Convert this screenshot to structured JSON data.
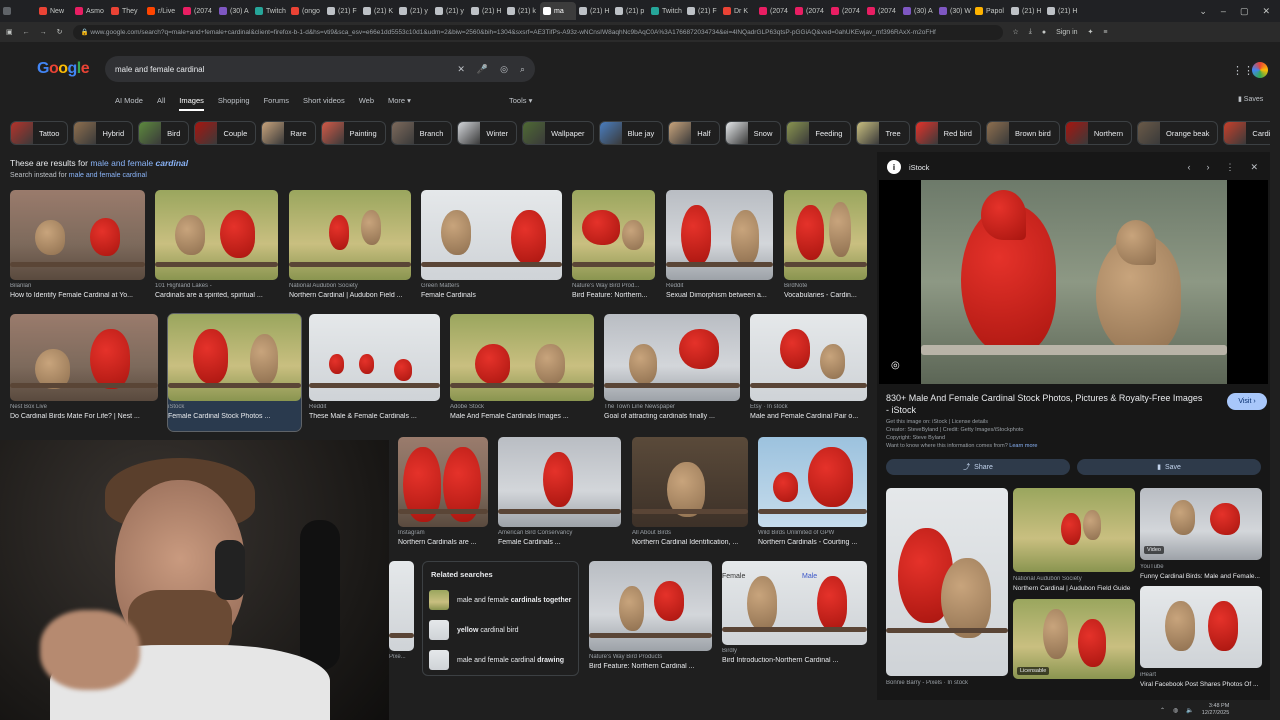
{
  "tabs": [
    {
      "label": "",
      "color": "#5f6368"
    },
    {
      "label": "New",
      "color": "#ea4335"
    },
    {
      "label": "Asmo",
      "color": "#e91e63"
    },
    {
      "label": "They",
      "color": "#ea4335"
    },
    {
      "label": "r/Live",
      "color": "#ff4500"
    },
    {
      "label": "(2074",
      "color": "#e91e63"
    },
    {
      "label": "(30) A",
      "color": "#7e57c2"
    },
    {
      "label": "Twitch",
      "color": "#26a69a"
    },
    {
      "label": "(ongo",
      "color": "#ea4335"
    },
    {
      "label": "(21) F",
      "color": "#bdc1c6"
    },
    {
      "label": "(21) K",
      "color": "#bdc1c6"
    },
    {
      "label": "(21) y",
      "color": "#bdc1c6"
    },
    {
      "label": "(21) y",
      "color": "#bdc1c6"
    },
    {
      "label": "(21) H",
      "color": "#bdc1c6"
    },
    {
      "label": "(21) k",
      "color": "#bdc1c6"
    },
    {
      "label": "ma",
      "color": "#ffffff",
      "active": true
    },
    {
      "label": "(21) H",
      "color": "#bdc1c6"
    },
    {
      "label": "(21) p",
      "color": "#bdc1c6"
    },
    {
      "label": "Twitch",
      "color": "#26a69a"
    },
    {
      "label": "(21) F",
      "color": "#bdc1c6"
    },
    {
      "label": "Dr K",
      "color": "#ea4335"
    },
    {
      "label": "(2074",
      "color": "#e91e63"
    },
    {
      "label": "(2074",
      "color": "#e91e63"
    },
    {
      "label": "(2074",
      "color": "#e91e63"
    },
    {
      "label": "(2074",
      "color": "#e91e63"
    },
    {
      "label": "(30) A",
      "color": "#7e57c2"
    },
    {
      "label": "(30) W",
      "color": "#7e57c2"
    },
    {
      "label": "Papol",
      "color": "#ffb300"
    },
    {
      "label": "(21) H",
      "color": "#bdc1c6"
    },
    {
      "label": "(21) H",
      "color": "#bdc1c6"
    }
  ],
  "window": {
    "signin": "Sign in"
  },
  "address": {
    "url": "www.google.com/search?q=male+and+female+cardinal&client=firefox-b-1-d&hs=vti9&sca_esv=e66e1dd5553c10d1&udm=2&biw=2560&bih=1304&sxsrf=AE3TifPs-A93z-wNCnsIW8aqhNc9bAqC0A%3A1766872034734&ei=4lNQadrGLP63qtsP-pGGiAQ&ved=0ahUKEwjav_mf396RAxX-m2oFHf",
    "signin": "Sign in"
  },
  "google": {
    "logo": "Google",
    "query": "male and female cardinal",
    "nav": [
      "AI Mode",
      "All",
      "Images",
      "Shopping",
      "Forums",
      "Short videos",
      "Web",
      "More ▾"
    ],
    "tools": "Tools ▾",
    "saves": "Saves"
  },
  "chips": [
    {
      "label": "Tattoo",
      "color": "#b5332b"
    },
    {
      "label": "Hybrid",
      "color": "#8e6f4f"
    },
    {
      "label": "Bird",
      "color": "#5d8a3e"
    },
    {
      "label": "Couple",
      "color": "#a8150f"
    },
    {
      "label": "Rare",
      "color": "#c8a47c"
    },
    {
      "label": "Painting",
      "color": "#d35a48"
    },
    {
      "label": "Branch",
      "color": "#7d6a5c"
    },
    {
      "label": "Winter",
      "color": "#d3d6da"
    },
    {
      "label": "Wallpaper",
      "color": "#4f6a34"
    },
    {
      "label": "Blue jay",
      "color": "#4a7ec0"
    },
    {
      "label": "Half",
      "color": "#c8a47c"
    },
    {
      "label": "Snow",
      "color": "#e5e8ea"
    },
    {
      "label": "Feeding",
      "color": "#8a9550"
    },
    {
      "label": "Tree",
      "color": "#c9bf80"
    },
    {
      "label": "Red bird",
      "color": "#e5322a"
    },
    {
      "label": "Brown bird",
      "color": "#8e6f4f"
    },
    {
      "label": "Northern",
      "color": "#a8150f"
    },
    {
      "label": "Orange beak",
      "color": "#6a5a48"
    },
    {
      "label": "Cardinals male",
      "color": "#c8402b"
    }
  ],
  "results_note": {
    "prefix": "These are results for ",
    "query_plain": "male and female ",
    "query_em": "cardinal",
    "instead_prefix": "Search instead for ",
    "instead_link": "male and female cardinal"
  },
  "results": [
    {
      "source": "Bilanlan",
      "title": "How to Identify Female Cardinal at Yo..."
    },
    {
      "source": "101 Highland Lakes -",
      "title": "Cardinals are a spirited, spiritual ..."
    },
    {
      "source": "National Audubon Society",
      "title": "Northern Cardinal | Audubon Field ..."
    },
    {
      "source": "Green Matters",
      "title": "Female Cardinals"
    },
    {
      "source": "Nature's Way Bird Prod...",
      "title": "Bird Feature: Northern..."
    },
    {
      "source": "Reddit",
      "title": "Sexual Dimorphism between a..."
    },
    {
      "source": "BirdNote",
      "title": "Vocabularies - Cardin..."
    },
    {
      "source": "Nest Box Live",
      "title": "Do Cardinal Birds Mate For Life? | Nest ..."
    },
    {
      "source": "iStock",
      "title": "Female Cardinal Stock Photos ..."
    },
    {
      "source": "Reddit",
      "title": "These Male & Female Cardinals ..."
    },
    {
      "source": "Adobe Stock",
      "title": "Male And Female Cardinals Images ..."
    },
    {
      "source": "The Town Line Newspaper",
      "title": "Goal of attracting cardinals finally ..."
    },
    {
      "source": "Etsy · In stock",
      "title": "Male and Female Cardinal Pair o..."
    },
    {
      "source": "Instagram",
      "title": "Northern Cardinals are ..."
    },
    {
      "source": "American Bird Conservancy",
      "title": "Female Cardinals ..."
    },
    {
      "source": "All About Birds",
      "title": "Northern Cardinal Identification, ..."
    },
    {
      "source": "Wild Birds Unlimited of GPW",
      "title": "Northern Cardinals - Courting ..."
    },
    {
      "source": "Nature's Way Bird Products",
      "title": "Bird Feature: Northern Cardinal ..."
    },
    {
      "source": "Birdly",
      "title": "Bird Introduction-Northern Cardinal ..."
    },
    {
      "source": "Pixe...",
      "title": ""
    }
  ],
  "overlay_labels": {
    "female": "Female",
    "male": "Male"
  },
  "related": {
    "heading": "Related searches",
    "items": [
      {
        "plain": "male and female ",
        "bold": "cardinals together"
      },
      {
        "plain": "",
        "bold": "yellow",
        "tail": " cardinal bird"
      },
      {
        "plain": "male and female cardinal ",
        "bold": "drawing"
      }
    ]
  },
  "panel": {
    "site": "iStock",
    "title": "830+ Male And Female Cardinal Stock Photos, Pictures & Royalty-Free Images - iStock",
    "visit": "Visit ›",
    "meta1": "Get this image on: iStock | License details",
    "meta2": "Creator: SteveByland | Credit: Getty Images/iStockphoto",
    "meta3": "Copyright: Steve Byland",
    "learn_prefix": "Want to know where this information comes from? ",
    "learn_link": "Learn more",
    "share": "Share",
    "save": "Save",
    "related": [
      {
        "source": "Bonnie Barry - Pixels · In stock",
        "title": ""
      },
      {
        "source": "National Audubon Society",
        "title": "Northern Cardinal | Audubon Field Guide"
      },
      {
        "source": "YouTube",
        "title": "Funny Cardinal Birds: Male and Female..."
      },
      {
        "source": "",
        "title": "",
        "badge": "Licensable"
      },
      {
        "source": "iHeart",
        "title": "Viral Facebook Post Shares Photos Of ..."
      }
    ],
    "video_badge": "Video"
  },
  "taskbar": {
    "time": "3:48 PM",
    "date": "12/27/2025"
  }
}
